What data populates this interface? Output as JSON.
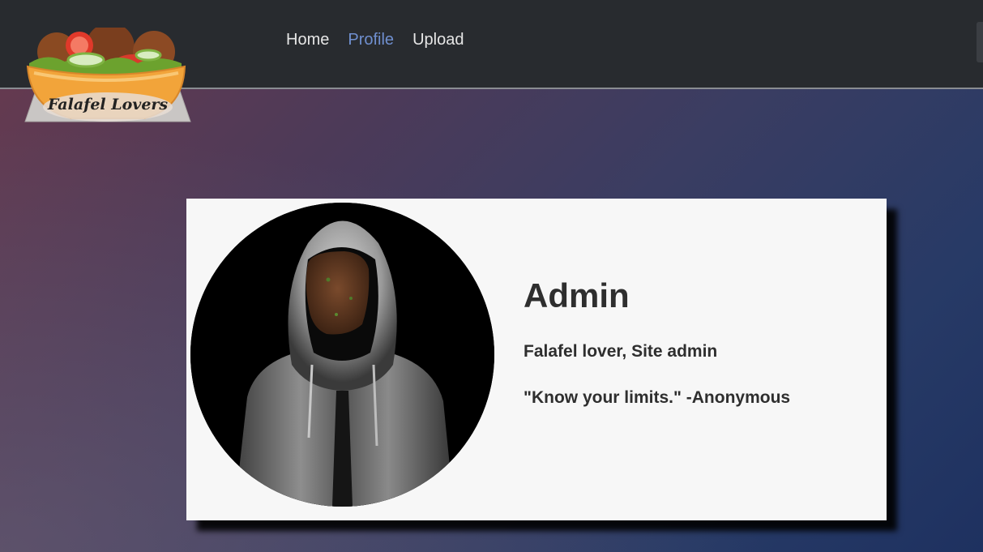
{
  "site": {
    "logo_text": "Falafel Lovers"
  },
  "nav": {
    "items": [
      {
        "label": "Home",
        "active": false
      },
      {
        "label": "Profile",
        "active": true
      },
      {
        "label": "Upload",
        "active": false
      }
    ]
  },
  "profile": {
    "name": "Admin",
    "role": "Falafel lover, Site admin",
    "quote": "\"Know your limits.\" -Anonymous"
  },
  "colors": {
    "navbar_bg": "#282b2f",
    "nav_link": "#e6e6e6",
    "nav_link_active": "#6f8fcf",
    "card_bg": "#f7f7f7",
    "text": "#2e2e2e"
  },
  "icons": {
    "logo": "falafel-bowl-logo",
    "avatar": "hooded-figure-falafel-face"
  }
}
